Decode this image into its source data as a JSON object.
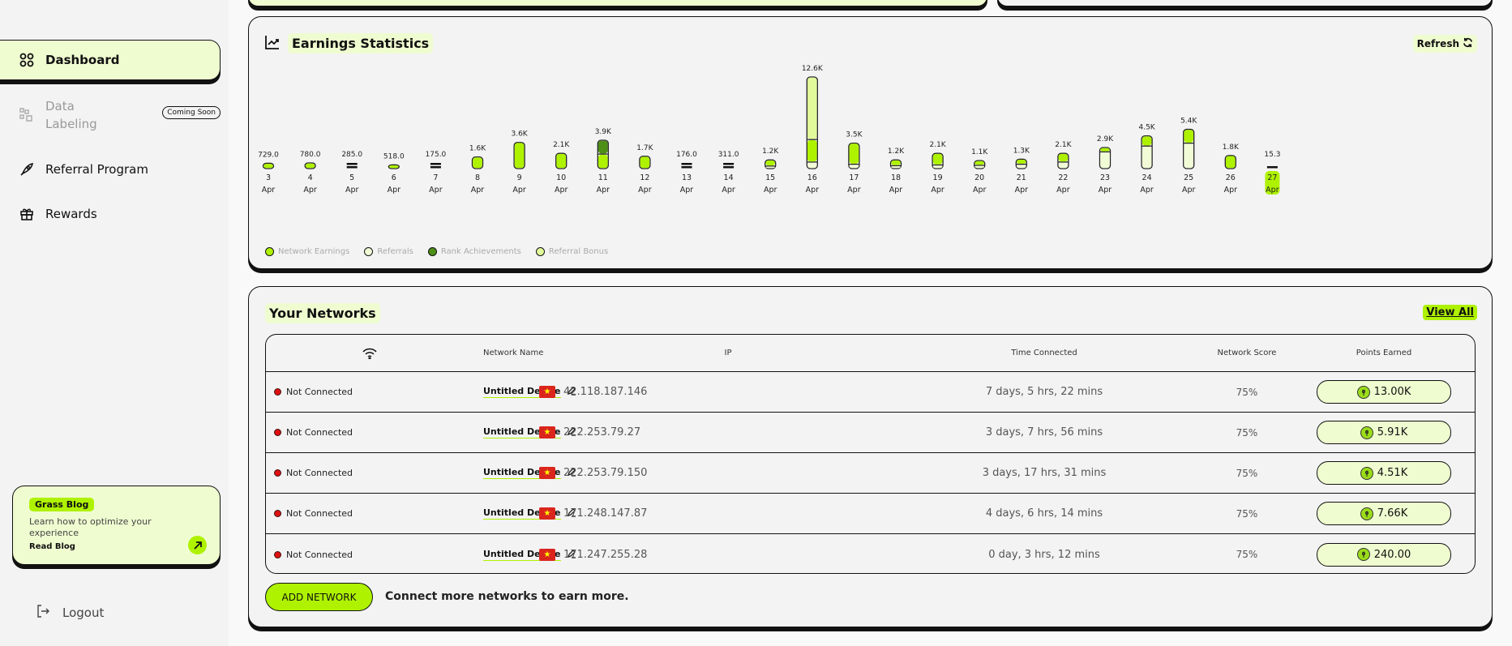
{
  "sidebar": {
    "items": [
      {
        "label": "Dashboard",
        "icon": "grid-icon",
        "active": true
      },
      {
        "label": "Data\nLabeling",
        "label_line1": "Data",
        "label_line2": "Labeling",
        "icon": "data-labeling-icon",
        "badge": "Coming Soon",
        "disabled": true
      },
      {
        "label": "Referral Program",
        "icon": "rocket-icon"
      },
      {
        "label": "Rewards",
        "icon": "gift-icon"
      }
    ],
    "blog": {
      "tag": "Grass Blog",
      "description": "Learn how to optimize your experience",
      "link": "Read Blog"
    },
    "logout": "Logout"
  },
  "earnings": {
    "title": "Earnings Statistics",
    "refresh_label": "Refresh"
  },
  "chart_data": {
    "type": "bar",
    "stacked": true,
    "title": "Earnings Statistics",
    "xlabel": "",
    "ylabel": "",
    "categories": [
      "3 Apr",
      "4 Apr",
      "5 Apr",
      "6 Apr",
      "7 Apr",
      "8 Apr",
      "9 Apr",
      "10 Apr",
      "11 Apr",
      "12 Apr",
      "13 Apr",
      "14 Apr",
      "15 Apr",
      "16 Apr",
      "17 Apr",
      "18 Apr",
      "19 Apr",
      "20 Apr",
      "21 Apr",
      "22 Apr",
      "23 Apr",
      "24 Apr",
      "25 Apr",
      "26 Apr",
      "27 Apr"
    ],
    "day_labels": [
      "3",
      "4",
      "5",
      "6",
      "7",
      "8",
      "9",
      "10",
      "11",
      "12",
      "13",
      "14",
      "15",
      "16",
      "17",
      "18",
      "19",
      "20",
      "21",
      "22",
      "23",
      "24",
      "25",
      "26",
      "27"
    ],
    "month_label": "Apr",
    "highlighted_category": "27 Apr",
    "totals_labels": [
      "729.0",
      "780.0",
      "285.0",
      "518.0",
      "175.0",
      "1.6K",
      "3.6K",
      "2.1K",
      "3.9K",
      "1.7K",
      "176.0",
      "311.0",
      "1.2K",
      "12.6K",
      "3.5K",
      "1.2K",
      "2.1K",
      "1.1K",
      "1.3K",
      "2.1K",
      "2.9K",
      "4.5K",
      "5.4K",
      "1.8K",
      "15.3"
    ],
    "totals": [
      729,
      780,
      285,
      518,
      175,
      1600,
      3600,
      2100,
      3900,
      1700,
      176,
      311,
      1200,
      12600,
      3500,
      1200,
      2100,
      1100,
      1300,
      2100,
      2900,
      4500,
      5400,
      1800,
      15.3
    ],
    "series": [
      {
        "name": "Referrals",
        "color": "#f1fcd6",
        "values": [
          0,
          0,
          0,
          0,
          0,
          0,
          0,
          0,
          0,
          0,
          0,
          0,
          350,
          900,
          600,
          400,
          500,
          450,
          600,
          900,
          2300,
          3100,
          3500,
          0,
          0
        ]
      },
      {
        "name": "Network Earnings",
        "color": "#aef200",
        "values": [
          729,
          780,
          285,
          518,
          175,
          1600,
          3600,
          2100,
          2000,
          1700,
          176,
          311,
          850,
          3100,
          2900,
          800,
          1600,
          650,
          700,
          1200,
          600,
          1400,
          1900,
          1800,
          15.3
        ]
      },
      {
        "name": "Rank Achievements",
        "color": "#4e8f18",
        "values": [
          0,
          0,
          0,
          0,
          0,
          0,
          0,
          0,
          1900,
          0,
          0,
          0,
          0,
          0,
          0,
          0,
          0,
          0,
          0,
          0,
          0,
          0,
          0,
          0,
          0
        ]
      },
      {
        "name": "Referral Bonus",
        "color": "#e2fb9a",
        "values": [
          0,
          0,
          0,
          0,
          0,
          0,
          0,
          0,
          0,
          0,
          0,
          0,
          0,
          8600,
          0,
          0,
          0,
          0,
          0,
          0,
          0,
          0,
          0,
          0,
          0
        ]
      }
    ],
    "legend": [
      "Network Earnings",
      "Referrals",
      "Rank Achievements",
      "Referral Bonus"
    ],
    "legend_position": "bottom-left",
    "ylim": [
      0,
      12600
    ],
    "grid": false
  },
  "networks": {
    "title": "Your Networks",
    "view_all": "View All",
    "columns": [
      "",
      "Network Name",
      "IP",
      "Time Connected",
      "Network Score",
      "Points Earned"
    ],
    "rows": [
      {
        "status": "Not Connected",
        "name": "Untitled Device",
        "ip": "42.118.187.146",
        "time": "7 days, 5 hrs, 22 mins",
        "score": "75%",
        "points": "13.00K"
      },
      {
        "status": "Not Connected",
        "name": "Untitled Device",
        "ip": "222.253.79.27",
        "time": "3 days, 7 hrs, 56 mins",
        "score": "75%",
        "points": "5.91K"
      },
      {
        "status": "Not Connected",
        "name": "Untitled Device",
        "ip": "222.253.79.150",
        "time": "3 days, 17 hrs, 31 mins",
        "score": "75%",
        "points": "4.51K"
      },
      {
        "status": "Not Connected",
        "name": "Untitled Device",
        "ip": "171.248.147.87",
        "time": "4 days, 6 hrs, 14 mins",
        "score": "75%",
        "points": "7.66K"
      },
      {
        "status": "Not Connected",
        "name": "Untitled Device",
        "ip": "171.247.255.28",
        "time": "0 day, 3 hrs, 12 mins",
        "score": "75%",
        "points": "240.00"
      }
    ],
    "add_button": "ADD NETWORK",
    "add_hint": "Connect more networks to earn more."
  },
  "colors": {
    "accent": "#aef200",
    "accent_pale": "#effcd0",
    "status_disconnected": "#dd1111",
    "border": "#111111"
  }
}
